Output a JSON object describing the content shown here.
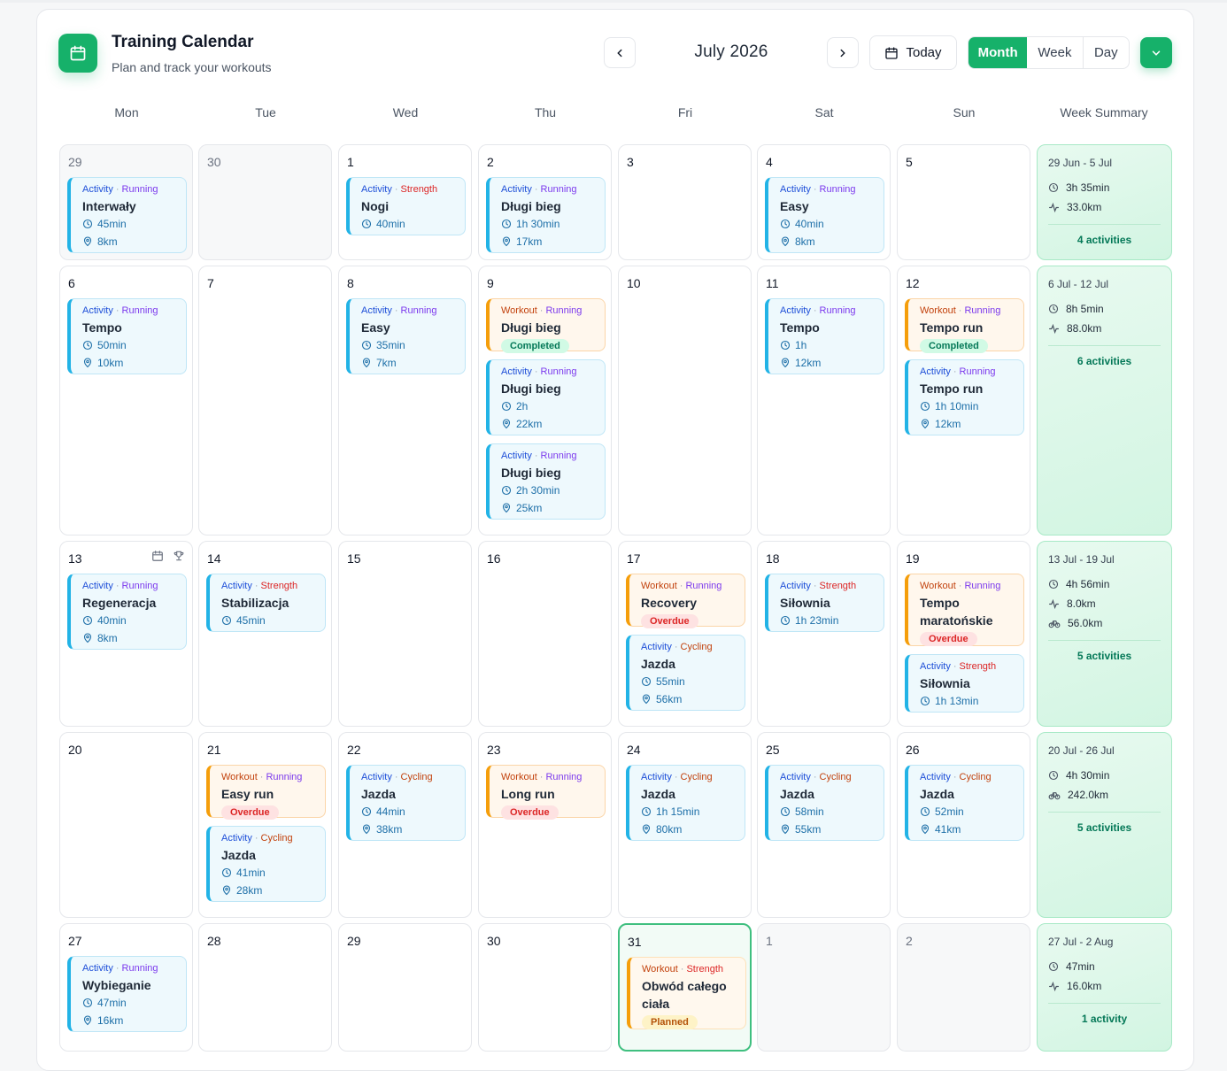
{
  "header": {
    "title": "Training Calendar",
    "subtitle": "Plan and track your workouts",
    "month_label": "July 2026",
    "today_label": "Today",
    "views": [
      "Month",
      "Week",
      "Day"
    ],
    "active_view": "Month"
  },
  "weekdays": [
    "Mon",
    "Tue",
    "Wed",
    "Thu",
    "Fri",
    "Sat",
    "Sun",
    "Week Summary"
  ],
  "colors": {
    "accent": "#16b16a",
    "activity": "#22b3e6",
    "workout": "#f59e0b"
  },
  "weeks": [
    {
      "days": [
        {
          "num": "29",
          "out": true,
          "entries": [
            {
              "kind": "Activity",
              "sport": "Running",
              "name": "Interwały",
              "time": "45min",
              "dist": "8km"
            }
          ]
        },
        {
          "num": "30",
          "out": true,
          "entries": []
        },
        {
          "num": "1",
          "entries": [
            {
              "kind": "Activity",
              "sport": "Strength",
              "name": "Nogi",
              "time": "40min"
            }
          ]
        },
        {
          "num": "2",
          "entries": [
            {
              "kind": "Activity",
              "sport": "Running",
              "name": "Długi bieg",
              "time": "1h 30min",
              "dist": "17km"
            }
          ]
        },
        {
          "num": "3",
          "entries": []
        },
        {
          "num": "4",
          "entries": [
            {
              "kind": "Activity",
              "sport": "Running",
              "name": "Easy",
              "time": "40min",
              "dist": "8km"
            }
          ]
        },
        {
          "num": "5",
          "entries": []
        }
      ],
      "summary": {
        "range": "29 Jun - 5 Jul",
        "time": "3h 35min",
        "run": "33.0km",
        "count": "4 activities"
      }
    },
    {
      "days": [
        {
          "num": "6",
          "entries": [
            {
              "kind": "Activity",
              "sport": "Running",
              "name": "Tempo",
              "time": "50min",
              "dist": "10km"
            }
          ]
        },
        {
          "num": "7",
          "entries": []
        },
        {
          "num": "8",
          "entries": [
            {
              "kind": "Activity",
              "sport": "Running",
              "name": "Easy",
              "time": "35min",
              "dist": "7km"
            }
          ]
        },
        {
          "num": "9",
          "entries": [
            {
              "kind": "Workout",
              "sport": "Running",
              "name": "Długi bieg",
              "status": "Completed"
            },
            {
              "kind": "Activity",
              "sport": "Running",
              "name": "Długi bieg",
              "time": "2h",
              "dist": "22km"
            },
            {
              "kind": "Activity",
              "sport": "Running",
              "name": "Długi bieg",
              "time": "2h 30min",
              "dist": "25km"
            }
          ]
        },
        {
          "num": "10",
          "entries": []
        },
        {
          "num": "11",
          "entries": [
            {
              "kind": "Activity",
              "sport": "Running",
              "name": "Tempo",
              "time": "1h",
              "dist": "12km"
            }
          ]
        },
        {
          "num": "12",
          "entries": [
            {
              "kind": "Workout",
              "sport": "Running",
              "name": "Tempo run",
              "status": "Completed"
            },
            {
              "kind": "Activity",
              "sport": "Running",
              "name": "Tempo run",
              "time": "1h 10min",
              "dist": "12km"
            }
          ]
        }
      ],
      "summary": {
        "range": "6 Jul - 12 Jul",
        "time": "8h 5min",
        "run": "88.0km",
        "count": "6 activities"
      }
    },
    {
      "days": [
        {
          "num": "13",
          "icons": [
            "calendar-icon",
            "trophy-icon"
          ],
          "entries": [
            {
              "kind": "Activity",
              "sport": "Running",
              "name": "Regeneracja",
              "time": "40min",
              "dist": "8km"
            }
          ]
        },
        {
          "num": "14",
          "entries": [
            {
              "kind": "Activity",
              "sport": "Strength",
              "name": "Stabilizacja",
              "time": "45min"
            }
          ]
        },
        {
          "num": "15",
          "entries": []
        },
        {
          "num": "16",
          "entries": []
        },
        {
          "num": "17",
          "entries": [
            {
              "kind": "Workout",
              "sport": "Running",
              "name": "Recovery",
              "status": "Overdue"
            },
            {
              "kind": "Activity",
              "sport": "Cycling",
              "name": "Jazda",
              "time": "55min",
              "dist": "56km"
            }
          ]
        },
        {
          "num": "18",
          "entries": [
            {
              "kind": "Activity",
              "sport": "Strength",
              "name": "Siłownia",
              "time": "1h 23min"
            }
          ]
        },
        {
          "num": "19",
          "entries": [
            {
              "kind": "Workout",
              "sport": "Running",
              "name": "Tempo maratońskie",
              "status": "Overdue"
            },
            {
              "kind": "Activity",
              "sport": "Strength",
              "name": "Siłownia",
              "time": "1h 13min"
            }
          ]
        }
      ],
      "summary": {
        "range": "13 Jul - 19 Jul",
        "time": "4h 56min",
        "run": "8.0km",
        "bike": "56.0km",
        "count": "5 activities"
      }
    },
    {
      "days": [
        {
          "num": "20",
          "entries": []
        },
        {
          "num": "21",
          "entries": [
            {
              "kind": "Workout",
              "sport": "Running",
              "name": "Easy run",
              "status": "Overdue"
            },
            {
              "kind": "Activity",
              "sport": "Cycling",
              "name": "Jazda",
              "time": "41min",
              "dist": "28km"
            }
          ]
        },
        {
          "num": "22",
          "entries": [
            {
              "kind": "Activity",
              "sport": "Cycling",
              "name": "Jazda",
              "time": "44min",
              "dist": "38km"
            }
          ]
        },
        {
          "num": "23",
          "entries": [
            {
              "kind": "Workout",
              "sport": "Running",
              "name": "Long run",
              "status": "Overdue"
            }
          ]
        },
        {
          "num": "24",
          "entries": [
            {
              "kind": "Activity",
              "sport": "Cycling",
              "name": "Jazda",
              "time": "1h 15min",
              "dist": "80km"
            }
          ]
        },
        {
          "num": "25",
          "entries": [
            {
              "kind": "Activity",
              "sport": "Cycling",
              "name": "Jazda",
              "time": "58min",
              "dist": "55km"
            }
          ]
        },
        {
          "num": "26",
          "entries": [
            {
              "kind": "Activity",
              "sport": "Cycling",
              "name": "Jazda",
              "time": "52min",
              "dist": "41km"
            }
          ]
        }
      ],
      "summary": {
        "range": "20 Jul - 26 Jul",
        "time": "4h 30min",
        "bike": "242.0km",
        "count": "5 activities"
      }
    },
    {
      "days": [
        {
          "num": "27",
          "entries": [
            {
              "kind": "Activity",
              "sport": "Running",
              "name": "Wybieganie",
              "time": "47min",
              "dist": "16km"
            }
          ]
        },
        {
          "num": "28",
          "entries": []
        },
        {
          "num": "29",
          "entries": []
        },
        {
          "num": "30",
          "entries": []
        },
        {
          "num": "31",
          "today": true,
          "entries": [
            {
              "kind": "Workout",
              "sport": "Strength",
              "name": "Obwód całego ciała",
              "status": "Planned"
            }
          ]
        },
        {
          "num": "1",
          "out": true,
          "entries": []
        },
        {
          "num": "2",
          "out": true,
          "entries": []
        }
      ],
      "summary": {
        "range": "27 Jul - 2 Aug",
        "time": "47min",
        "run": "16.0km",
        "count": "1 activity"
      }
    }
  ]
}
